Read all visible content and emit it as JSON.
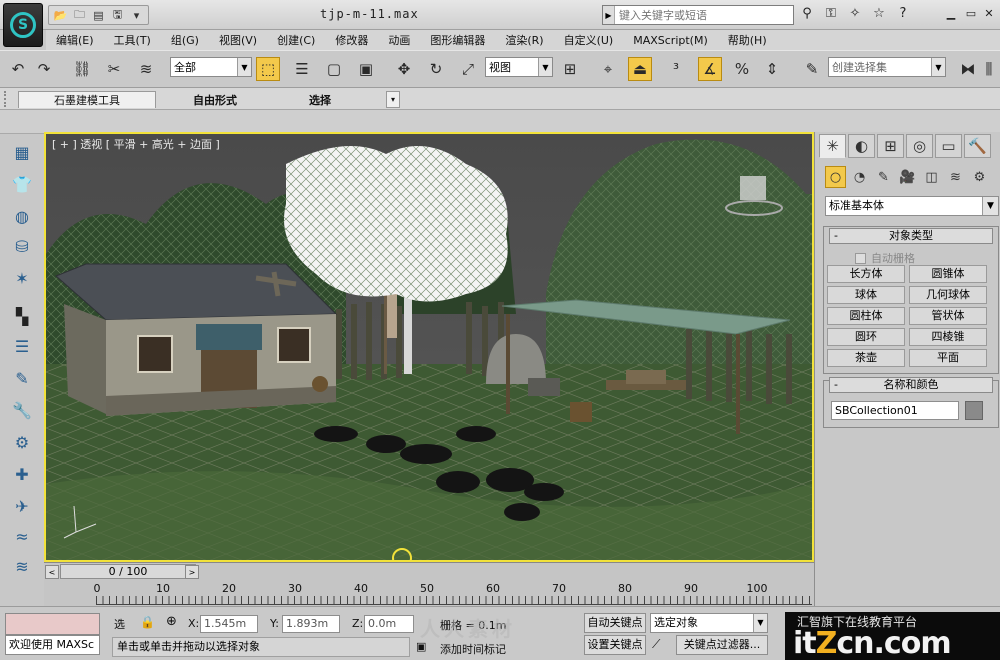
{
  "window": {
    "title": "tjp-m-11.max",
    "search_placeholder": "键入关键字或短语"
  },
  "menu": [
    "编辑(E)",
    "工具(T)",
    "组(G)",
    "视图(V)",
    "创建(C)",
    "修改器",
    "动画",
    "图形编辑器",
    "渲染(R)",
    "自定义(U)",
    "MAXScript(M)",
    "帮助(H)"
  ],
  "toolbar": {
    "selection_filter": "全部",
    "reference_coord": "视图",
    "named_selection_placeholder": "创建选择集"
  },
  "ribbon": {
    "tabs": [
      "石墨建模工具",
      "自由形式",
      "选择"
    ]
  },
  "viewport": {
    "label_parts": [
      "[ + ]",
      "透视",
      "[ 平滑 + 高光 + 边面 ]"
    ],
    "border_color": "#f2e23a"
  },
  "timeline": {
    "frame_display": "0 / 100",
    "prev_label": "<",
    "next_label": ">",
    "ticks": [
      "0",
      "10",
      "20",
      "30",
      "40",
      "50",
      "60",
      "70",
      "80",
      "90",
      "100"
    ]
  },
  "status": {
    "welcome": "欢迎使用 MAXSc",
    "selected_label": "选",
    "x_label": "X:",
    "x_value": "1.545m",
    "y_label": "Y:",
    "y_value": "1.893m",
    "z_label": "Z:",
    "z_value": "0.0m",
    "grid_label": "栅格 = 0.1m",
    "auto_key": "自动关键点",
    "set_key": "设置关键点",
    "key_mode_select": "选定对象",
    "key_filters": "关键点过滤器...",
    "prompt": "单击或单击并拖动以选择对象",
    "add_time_tag": "添加时间标记"
  },
  "command_panel": {
    "category": "标准基本体",
    "object_type_title": "对象类型",
    "auto_grid": "自动栅格",
    "object_buttons": [
      "长方体",
      "圆锥体",
      "球体",
      "几何球体",
      "圆柱体",
      "管状体",
      "圆环",
      "四棱锥",
      "茶壶",
      "平面"
    ],
    "name_color_title": "名称和颜色",
    "object_name": "SBCollection01"
  },
  "watermark": {
    "tagline": "汇智旗下在线教育平台",
    "logo_prefix": "it",
    "logo_z": "Z",
    "logo_suffix": "cn.com",
    "center_text": "人人素材"
  }
}
